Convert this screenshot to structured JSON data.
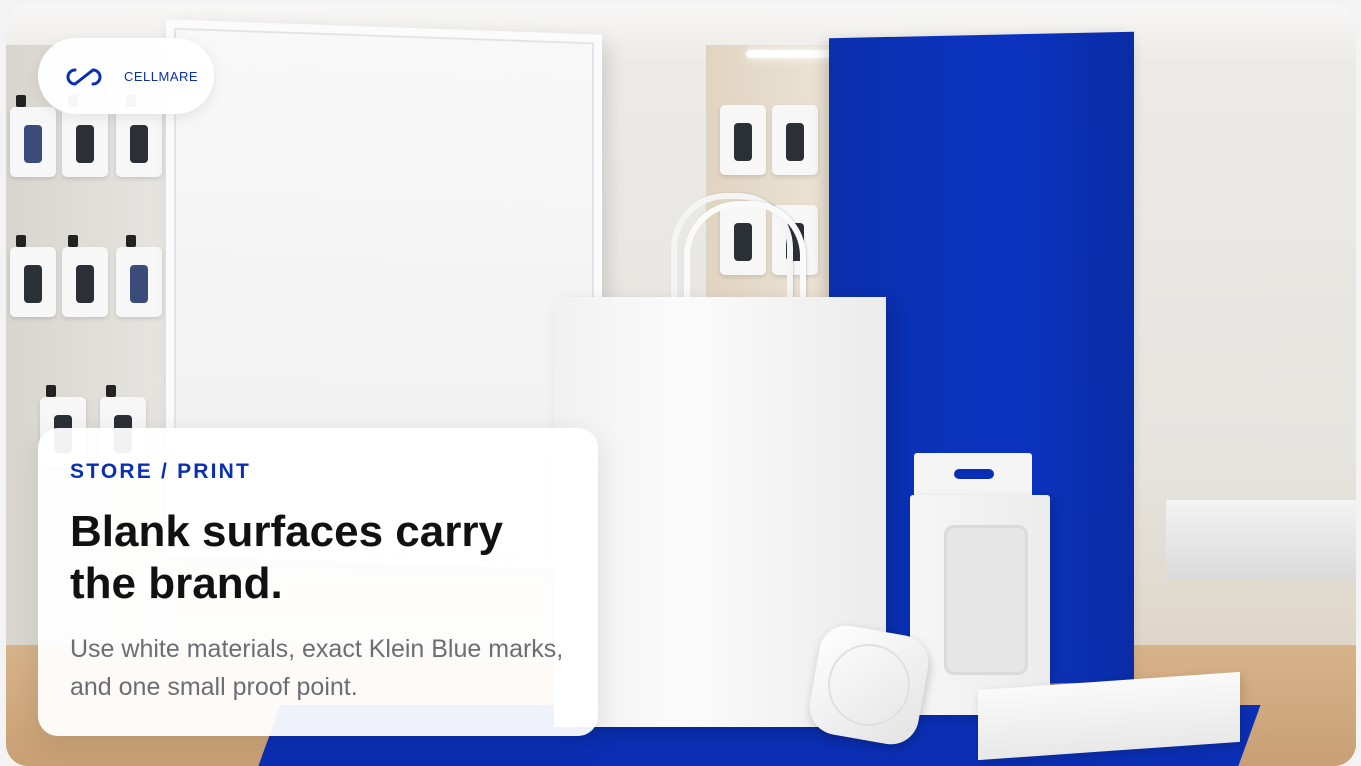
{
  "logo": {
    "icon": "infinity-loop-logo-icon",
    "wordmark": "CELLMARE"
  },
  "card": {
    "eyebrow": "STORE / PRINT",
    "headline": "Blank surfaces carry the brand.",
    "body": "Use white materials, exact Klein Blue marks, and one small proof point."
  },
  "colors": {
    "klein_blue": "#0B2FB4",
    "headline": "#111111",
    "body": "#6B6E74",
    "card_bg": "#FFFFFF"
  },
  "scene": {
    "description_icons": [
      "blank-frame",
      "shopping-bag",
      "blue-panel",
      "product-box",
      "wireless-charger"
    ]
  }
}
